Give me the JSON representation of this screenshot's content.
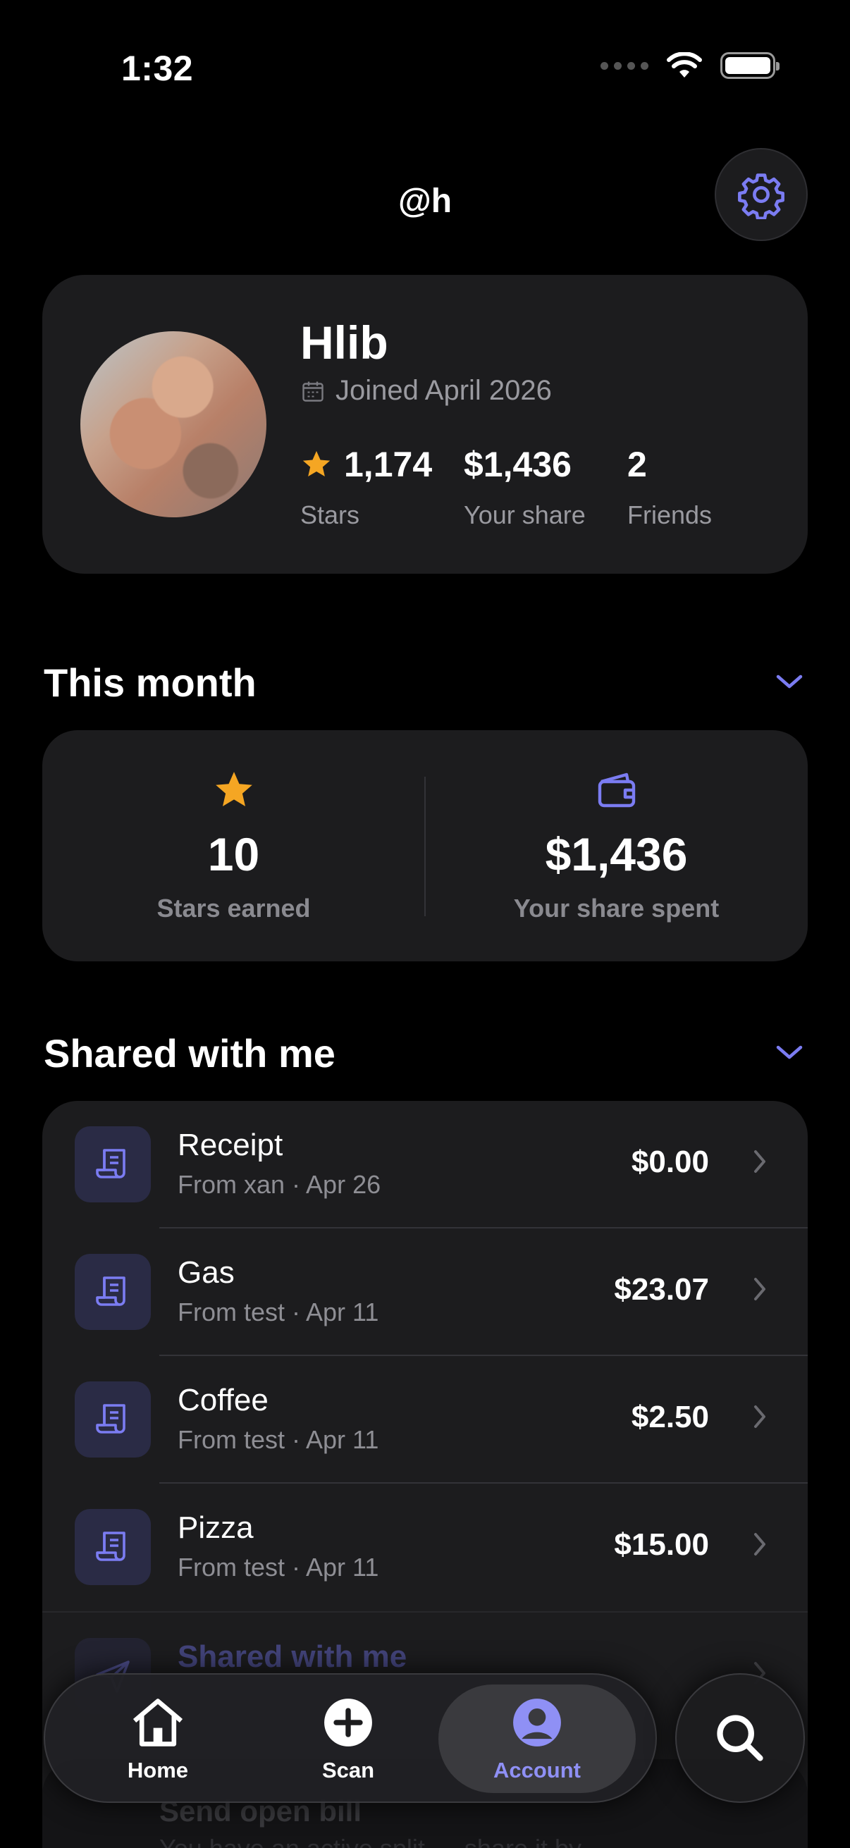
{
  "status_bar": {
    "time": "1:32"
  },
  "header": {
    "handle": "@h"
  },
  "profile": {
    "name": "Hlib",
    "joined": "Joined April 2026",
    "stats": [
      {
        "value": "1,174",
        "label": "Stars"
      },
      {
        "value": "$1,436",
        "label": "Your share"
      },
      {
        "value": "2",
        "label": "Friends"
      }
    ]
  },
  "this_month": {
    "title": "This month",
    "stars_value": "10",
    "stars_label": "Stars earned",
    "share_value": "$1,436",
    "share_label": "Your share spent"
  },
  "shared": {
    "title": "Shared with me",
    "items": [
      {
        "title": "Receipt",
        "subtitle": "From xan · Apr 26",
        "amount": "$0.00"
      },
      {
        "title": "Gas",
        "subtitle": "From test · Apr 11",
        "amount": "$23.07"
      },
      {
        "title": "Coffee",
        "subtitle": "From test · Apr 11",
        "amount": "$2.50"
      },
      {
        "title": "Pizza",
        "subtitle": "From test · Apr 11",
        "amount": "$15.00"
      }
    ],
    "link_row": "Shared with me"
  },
  "send_bill": {
    "title": "Send open bill",
    "subtitle": "You have an active split — share it by..."
  },
  "tabbar": {
    "home": "Home",
    "scan": "Scan",
    "account": "Account"
  },
  "colors": {
    "accent": "#7b7cf2",
    "star": "#f5a623",
    "card": "#1c1c1e"
  }
}
